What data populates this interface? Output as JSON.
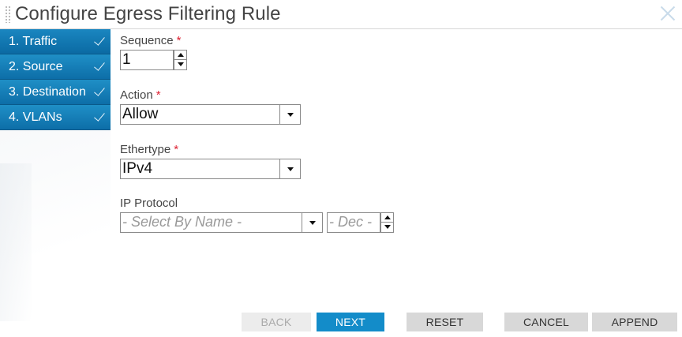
{
  "dialog": {
    "title": "Configure Egress Filtering Rule"
  },
  "steps": [
    {
      "label": "1. Traffic",
      "completed": true,
      "active": true
    },
    {
      "label": "2. Source",
      "completed": true,
      "active": false
    },
    {
      "label": "3. Destination",
      "completed": true,
      "active": false
    },
    {
      "label": "4. VLANs",
      "completed": true,
      "active": false
    }
  ],
  "form": {
    "sequence": {
      "label": "Sequence",
      "required": "*",
      "value": "1"
    },
    "action": {
      "label": "Action",
      "required": "*",
      "value": "Allow"
    },
    "ethertype": {
      "label": "Ethertype",
      "required": "*",
      "value": "IPv4"
    },
    "ip_protocol": {
      "label": "IP Protocol",
      "name_placeholder": "- Select By Name -",
      "dec_placeholder": "- Dec -"
    }
  },
  "buttons": {
    "back": "BACK",
    "next": "NEXT",
    "reset": "RESET",
    "cancel": "CANCEL",
    "append": "APPEND"
  },
  "colors": {
    "accent": "#138cc9",
    "step_bg": "#1380bb",
    "required": "#dd2233"
  }
}
